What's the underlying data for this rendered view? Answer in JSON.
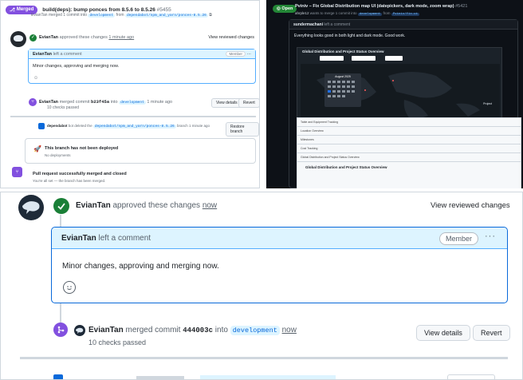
{
  "top_left": {
    "status_pill": "Merged",
    "title": "build(deps): bump ponces from 8.5.6 to 8.5.26",
    "pr_number": "#5455",
    "merge_sub_prefix": "EvianTan merged 1 commit into",
    "merge_sub_base": "development",
    "merge_sub_from": "from",
    "merge_sub_head": "dependabot/npm_and_yarn/ponces-8.5.26",
    "approve_user": "EvianTan",
    "approve_text": "approved these changes",
    "approve_time": "1 minute ago",
    "view_reviewed": "View reviewed changes",
    "comment_user": "EvianTan",
    "comment_action": "left a comment",
    "member_badge": "Member",
    "comment_body": "Minor changes, approving and merging now.",
    "merge_user": "EvianTan",
    "merge_text": "merged commit",
    "merge_hash": "b23f45a",
    "merge_into": "into",
    "merge_branch": "development",
    "merge_time": "1 minute ago",
    "checks": "10 checks passed",
    "view_details": "View details",
    "revert": "Revert",
    "deleted_user": "dependabot",
    "deleted_bot": "bot",
    "deleted_text": "deleted the",
    "deleted_branch": "dependabot/npm_and_yarn/ponces-8.5.26",
    "deleted_suffix": "branch 1 minute ago",
    "restore_branch": "Restore branch",
    "not_deployed": "This branch has not been deployed",
    "no_deployments": "No deployments",
    "merged_closed": "Pull request successfully merged and closed",
    "merged_closed_sub": "You're all set — the branch has been merged."
  },
  "top_right": {
    "status_pill": "Open",
    "title": "Pviniv – Fix Global Distribution map UI (datepickers, dark mode, zoom wrap)",
    "pr_number": "#5421",
    "sub_user": "ahrple12",
    "sub_text": "wants to merge 1 commit into",
    "sub_base": "development",
    "sub_from": "from",
    "sub_head": "Pviniv/fix-ui",
    "commenter": "sundermachani",
    "comment_action": "left a comment",
    "comment_body": "Everything looks good in both light and dark mode. Good work.",
    "map_title": "Global Distribution and Project Status Overview",
    "cal_month": "August 2025",
    "legend_title": "Project",
    "rows": [
      "Table and Equipment Tracking",
      "Location Overview",
      "Milestones",
      "Cost Tracking",
      "Global Distribution and Project Status Overview"
    ],
    "light_heading": "Global Distribution and Project Status Overview"
  },
  "bottom": {
    "approve_user": "EvianTan",
    "approve_text": "approved these changes",
    "approve_time": "now",
    "view_reviewed": "View reviewed changes",
    "comment_user": "EvianTan",
    "comment_action": "left a comment",
    "member_badge": "Member",
    "kebab": "···",
    "comment_body": "Minor changes, approving and merging now.",
    "merge_user": "EvianTan",
    "merge_text": "merged commit",
    "merge_hash": "444003c",
    "merge_into": "into",
    "merge_branch": "development",
    "merge_time": "now",
    "checks": "10 checks passed",
    "view_details": "View details",
    "revert": "Revert"
  },
  "colors": {
    "merged": "#8250df",
    "approved": "#1a7f37",
    "accent": "#0969da",
    "open": "#238636"
  }
}
